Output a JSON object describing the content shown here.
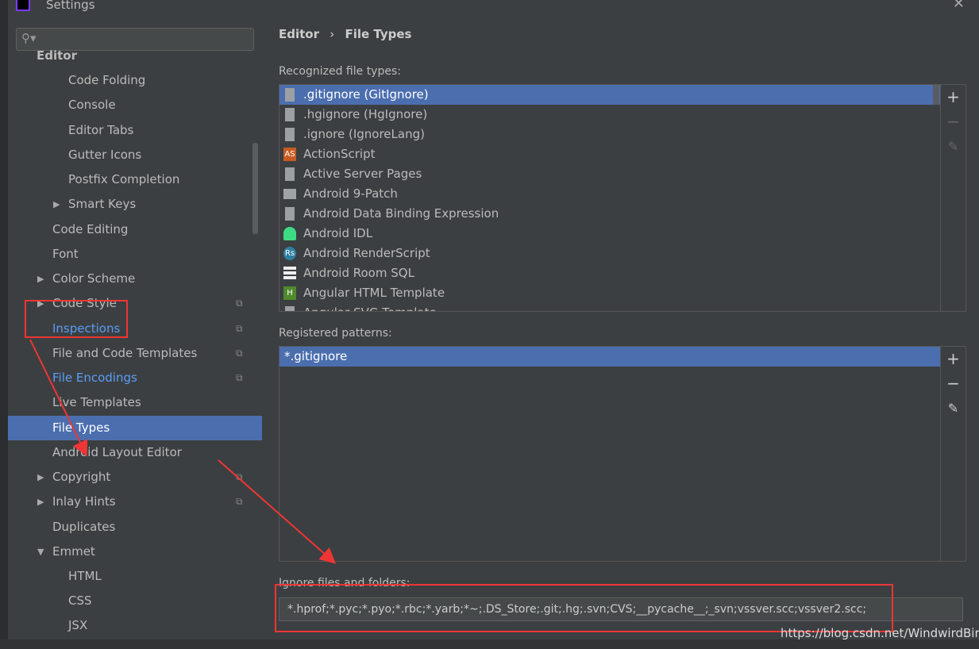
{
  "window": {
    "title": "Settings",
    "close": "✕"
  },
  "sidebar": {
    "search_placeholder": "",
    "items": [
      {
        "label": "Editor",
        "level": 0,
        "bold": true
      },
      {
        "label": "Code Folding",
        "level": 2
      },
      {
        "label": "Console",
        "level": 2
      },
      {
        "label": "Editor Tabs",
        "level": 2
      },
      {
        "label": "Gutter Icons",
        "level": 2
      },
      {
        "label": "Postfix Completion",
        "level": 2
      },
      {
        "label": "Smart Keys",
        "level": 2,
        "expandable": true
      },
      {
        "label": "Code Editing",
        "level": 1
      },
      {
        "label": "Font",
        "level": 1
      },
      {
        "label": "Color Scheme",
        "level": 1,
        "expandable": true
      },
      {
        "label": "Code Style",
        "level": 1,
        "expandable": true,
        "copy": true
      },
      {
        "label": "Inspections",
        "level": 1,
        "link": true,
        "copy": true
      },
      {
        "label": "File and Code Templates",
        "level": 1,
        "copy": true
      },
      {
        "label": "File Encodings",
        "level": 1,
        "link": true,
        "copy": true
      },
      {
        "label": "Live Templates",
        "level": 1
      },
      {
        "label": "File Types",
        "level": 1,
        "selected": true
      },
      {
        "label": "Android Layout Editor",
        "level": 1
      },
      {
        "label": "Copyright",
        "level": 1,
        "expandable": true,
        "copy": true
      },
      {
        "label": "Inlay Hints",
        "level": 1,
        "expandable": true,
        "copy": true
      },
      {
        "label": "Duplicates",
        "level": 1
      },
      {
        "label": "Emmet",
        "level": 1,
        "expanded": true
      },
      {
        "label": "HTML",
        "level": 2
      },
      {
        "label": "CSS",
        "level": 2
      },
      {
        "label": "JSX",
        "level": 2
      }
    ]
  },
  "main": {
    "breadcrumb": [
      "Editor",
      "File Types"
    ],
    "breadcrumb_sep": "›",
    "recognized_label": "Recognized file types:",
    "recognized": [
      {
        "label": ".gitignore (GitIgnore)",
        "icon": "ignore-file-icon",
        "selected": true
      },
      {
        "label": ".hgignore (HgIgnore)",
        "icon": "ignore-file-icon"
      },
      {
        "label": ".ignore (IgnoreLang)",
        "icon": "ignore-file-icon"
      },
      {
        "label": "ActionScript",
        "icon": "actionscript-icon",
        "badge": "AS",
        "color": "#c75b22"
      },
      {
        "label": "Active Server Pages",
        "icon": "asp-file-icon"
      },
      {
        "label": "Android 9-Patch",
        "icon": "folder-icon"
      },
      {
        "label": "Android Data Binding Expression",
        "icon": "asp-file-icon"
      },
      {
        "label": "Android IDL",
        "icon": "android-icon",
        "color": "#3ddc84"
      },
      {
        "label": "Android RenderScript",
        "icon": "renderscript-icon",
        "badge": "Rs",
        "color": "#2f7fa0"
      },
      {
        "label": "Android Room SQL",
        "icon": "database-icon"
      },
      {
        "label": "Angular HTML Template",
        "icon": "html-file-icon",
        "badge": "H",
        "color": "#4f8a2d"
      },
      {
        "label": "Angular SVG Template",
        "icon": "html-file-icon"
      }
    ],
    "patterns_label": "Registered patterns:",
    "patterns": [
      {
        "label": "*.gitignore",
        "selected": true
      }
    ],
    "tools": {
      "add": "+",
      "remove": "−",
      "edit": "✎"
    },
    "ignore_label": "Ignore files and folders:",
    "ignore_value": "*.hprof;*.pyc;*.pyo;*.rbc;*.yarb;*~;.DS_Store;.git;.hg;.svn;CVS;__pycache__;_svn;vssver.scc;vssver2.scc;"
  },
  "watermark": "https://blog.csdn.net/WindwirdBird",
  "colors": {
    "selection": "#4b6eaf",
    "link": "#589df6",
    "annotation": "#ef3535"
  }
}
